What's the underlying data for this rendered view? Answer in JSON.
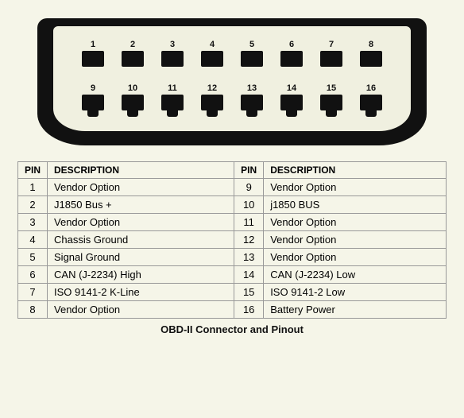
{
  "connector": {
    "top_row": [
      {
        "num": "1"
      },
      {
        "num": "2"
      },
      {
        "num": "3"
      },
      {
        "num": "4"
      },
      {
        "num": "5"
      },
      {
        "num": "6"
      },
      {
        "num": "7"
      },
      {
        "num": "8"
      }
    ],
    "bottom_row": [
      {
        "num": "9"
      },
      {
        "num": "10"
      },
      {
        "num": "11"
      },
      {
        "num": "12"
      },
      {
        "num": "13"
      },
      {
        "num": "14"
      },
      {
        "num": "15"
      },
      {
        "num": "16"
      }
    ]
  },
  "table": {
    "headers": [
      "PIN",
      "DESCRIPTION",
      "PIN",
      "DESCRIPTION"
    ],
    "rows": [
      {
        "pin1": "1",
        "desc1": "Vendor Option",
        "pin2": "9",
        "desc2": "Vendor Option"
      },
      {
        "pin1": "2",
        "desc1": "J1850 Bus +",
        "pin2": "10",
        "desc2": "j1850 BUS"
      },
      {
        "pin1": "3",
        "desc1": "Vendor Option",
        "pin2": "11",
        "desc2": "Vendor Option"
      },
      {
        "pin1": "4",
        "desc1": "Chassis Ground",
        "pin2": "12",
        "desc2": "Vendor Option"
      },
      {
        "pin1": "5",
        "desc1": "Signal Ground",
        "pin2": "13",
        "desc2": "Vendor Option"
      },
      {
        "pin1": "6",
        "desc1": "CAN (J-2234) High",
        "pin2": "14",
        "desc2": "CAN (J-2234) Low"
      },
      {
        "pin1": "7",
        "desc1": "ISO 9141-2 K-Line",
        "pin2": "15",
        "desc2": "ISO 9141-2 Low"
      },
      {
        "pin1": "8",
        "desc1": "Vendor Option",
        "pin2": "16",
        "desc2": "Battery Power"
      }
    ]
  },
  "caption": "OBD-II Connector and Pinout"
}
